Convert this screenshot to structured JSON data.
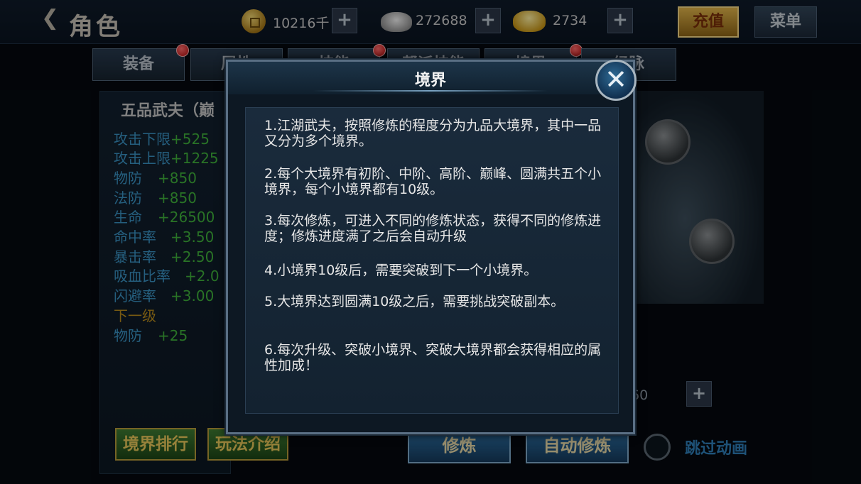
{
  "header": {
    "back_icon": "back-arrow-icon",
    "title": "角色",
    "resources": [
      {
        "name": "copper-coin",
        "value": "10216千"
      },
      {
        "name": "silver-ingot",
        "value": "272688"
      },
      {
        "name": "gold-ingot",
        "value": "2734"
      }
    ],
    "recharge_label": "充值",
    "menu_label": "菜单"
  },
  "tabs": [
    {
      "label": "装备"
    },
    {
      "label": "属性"
    },
    {
      "label": "技能"
    },
    {
      "label": "帮派技能"
    },
    {
      "label": "境界"
    },
    {
      "label": "经脉"
    }
  ],
  "left_panel": {
    "rank_name": "五品武夫（巅",
    "stats": [
      {
        "key": "攻击下限",
        "value": "+525"
      },
      {
        "key": "攻击上限",
        "value": "+1225"
      },
      {
        "key": "物防",
        "value": "+850"
      },
      {
        "key": "法防",
        "value": "+850"
      },
      {
        "key": "生命",
        "value": "+26500"
      },
      {
        "key": "命中率",
        "value": "+3.50"
      },
      {
        "key": "暴击率",
        "value": "+2.50"
      },
      {
        "key": "吸血比率",
        "value": "+2.0"
      },
      {
        "key": "闪避率",
        "value": "+3.00"
      }
    ],
    "next_level_label": "下一级",
    "next_stat": {
      "key": "物防",
      "value": "+25"
    },
    "ranking_button": "境界排行",
    "guide_button": "玩法介绍"
  },
  "right_panel": {
    "value_text": "60",
    "cultivate_button": "修炼",
    "auto_cultivate_button": "自动修炼",
    "skip_animation_label": "跳过动画"
  },
  "modal": {
    "title": "境界",
    "close_icon": "close-icon",
    "rules": [
      "1.江湖武夫，按照修炼的程度分为九品大境界，其中一品又分为多个境界。",
      "2.每个大境界有初阶、中阶、高阶、巅峰、圆满共五个小境界，每个小境界都有10级。",
      "3.每次修炼，可进入不同的修炼状态，获得不同的修炼进度；修炼进度满了之后会自动升级",
      "4.小境界10级后，需要突破到下一个小境界。",
      "5.大境界达到圆满10级之后，需要挑战突破副本。",
      "6.每次升级、突破小境界、突破大境界都会获得相应的属性加成！"
    ]
  }
}
